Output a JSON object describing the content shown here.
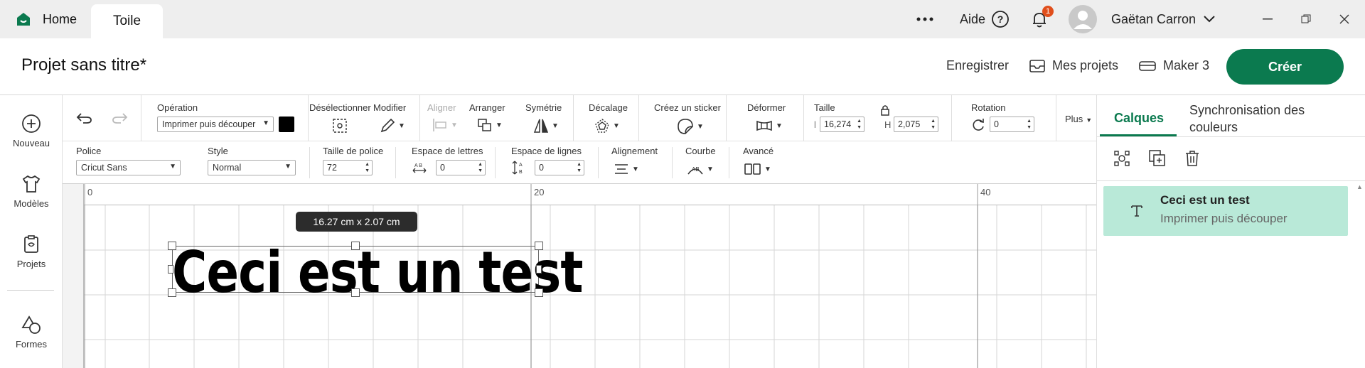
{
  "topbar": {
    "home_label": "Home",
    "canvas_tab_label": "Toile",
    "more_icon": "more-horizontal-icon",
    "help_label": "Aide",
    "notification_count": "1",
    "user_name": "Gaëtan Carron"
  },
  "project": {
    "title": "Projet sans titre*",
    "save_label": "Enregistrer",
    "my_projects_label": "Mes projets",
    "machine_label": "Maker 3",
    "create_label": "Créer"
  },
  "sidebar": {
    "items": [
      {
        "label": "Nouveau",
        "icon": "plus-circle-icon"
      },
      {
        "label": "Modèles",
        "icon": "shirt-icon"
      },
      {
        "label": "Projets",
        "icon": "project-icon"
      },
      {
        "label": "Formes",
        "icon": "shapes-icon"
      }
    ]
  },
  "toolbar1": {
    "operation_label": "Opération",
    "operation_value": "Imprimer puis découper",
    "deselect_label": "Désélectionner",
    "modify_label": "Modifier",
    "align_label": "Aligner",
    "arrange_label": "Arranger",
    "symmetry_label": "Symétrie",
    "offset_label": "Décalage",
    "sticker_label": "Créez un sticker",
    "warp_label": "Déformer",
    "size_label": "Taille",
    "width_prefix": "l",
    "width_value": "16,274",
    "height_prefix": "H",
    "height_value": "2,075",
    "rotation_label": "Rotation",
    "rotation_value": "0",
    "more_label": "Plus"
  },
  "toolbar2": {
    "font_label": "Police",
    "font_value": "Cricut Sans",
    "style_label": "Style",
    "style_value": "Normal",
    "font_size_label": "Taille de police",
    "font_size_value": "72",
    "letter_space_label": "Espace de lettres",
    "letter_space_value": "0",
    "line_space_label": "Espace de lignes",
    "line_space_value": "0",
    "alignment_label": "Alignement",
    "curve_label": "Courbe",
    "advanced_label": "Avancé"
  },
  "canvas": {
    "ruler_labels": [
      "0",
      "20",
      "40"
    ],
    "dimension_tooltip": "16.27  cm x 2.07  cm",
    "text_content": "Ceci est un test"
  },
  "right_panel": {
    "tab_layers": "Calques",
    "tab_sync": "Synchronisation des couleurs",
    "layer": {
      "title": "Ceci est un test",
      "subtitle": "Imprimer puis découper"
    }
  },
  "colors": {
    "accent": "#0b7a4f",
    "layer_highlight": "#b9e9d8",
    "notification_badge": "#e04e1b"
  }
}
